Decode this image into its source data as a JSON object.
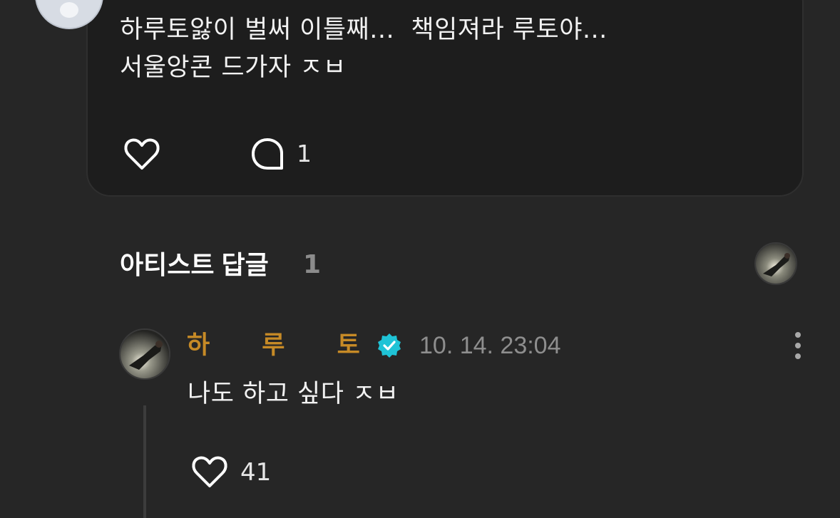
{
  "post": {
    "text_line1": "하루토앓이 벌써 이틀째...  책임져라 루토야...",
    "text_line2": "서울앙콘 드가자 ㅈㅂ",
    "comment_count": "1"
  },
  "artist_reply_section": {
    "title": "아티스트 답글",
    "count": "1"
  },
  "reply": {
    "author": "하      루      토",
    "timestamp": "10. 14. 23:04",
    "text": "나도 하고 싶다 ㅈㅂ",
    "like_count": "41"
  },
  "colors": {
    "background": "#262626",
    "card": "#1d1d1d",
    "author_name": "#c68a26",
    "verified_badge": "#1fc3d6",
    "muted": "#8e8e8e"
  },
  "icons": {
    "like": "heart-outline-icon",
    "comment": "speech-bubble-icon",
    "verified": "verified-badge-icon",
    "more": "vertical-dots-icon"
  }
}
